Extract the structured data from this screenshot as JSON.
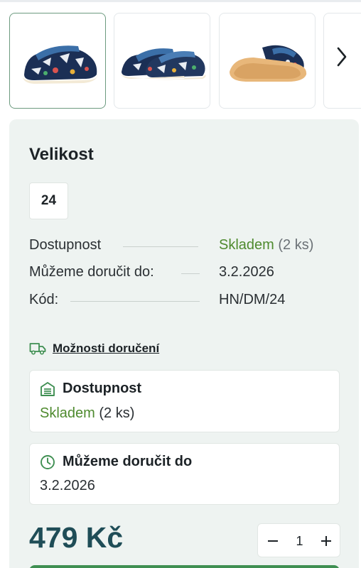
{
  "gallery": {
    "thumbnails": [
      {
        "alt": "shoe-side-view",
        "active": true
      },
      {
        "alt": "shoe-pair-view",
        "active": false
      },
      {
        "alt": "shoe-sole-view",
        "active": false
      }
    ],
    "next_icon": "chevron-right-icon"
  },
  "size": {
    "heading": "Velikost",
    "selected": "24"
  },
  "details": {
    "availability_label": "Dostupnost",
    "availability_value": "Skladem",
    "availability_count": "(2 ks)",
    "delivery_label": "Můžeme doručit do:",
    "delivery_value": "3.2.2026",
    "code_label": "Kód:",
    "code_value": "HN/DM/24"
  },
  "delivery_options": {
    "icon": "truck-icon",
    "label": "Možnosti doručení"
  },
  "cards": {
    "availability": {
      "icon": "warehouse-icon",
      "title": "Dostupnost",
      "status": "Skladem",
      "count": "(2 ks)"
    },
    "delivery": {
      "icon": "clock-icon",
      "title": "Můžeme doručit do",
      "date": "3.2.2026"
    }
  },
  "purchase": {
    "price": "479 Kč",
    "quantity": "1",
    "minus_icon": "minus-icon",
    "plus_icon": "plus-icon"
  },
  "colors": {
    "accent_green": "#4e8a2e",
    "price": "#1f4d57",
    "panel_bg": "#eef3f1",
    "buy_button": "#3f8f52"
  }
}
